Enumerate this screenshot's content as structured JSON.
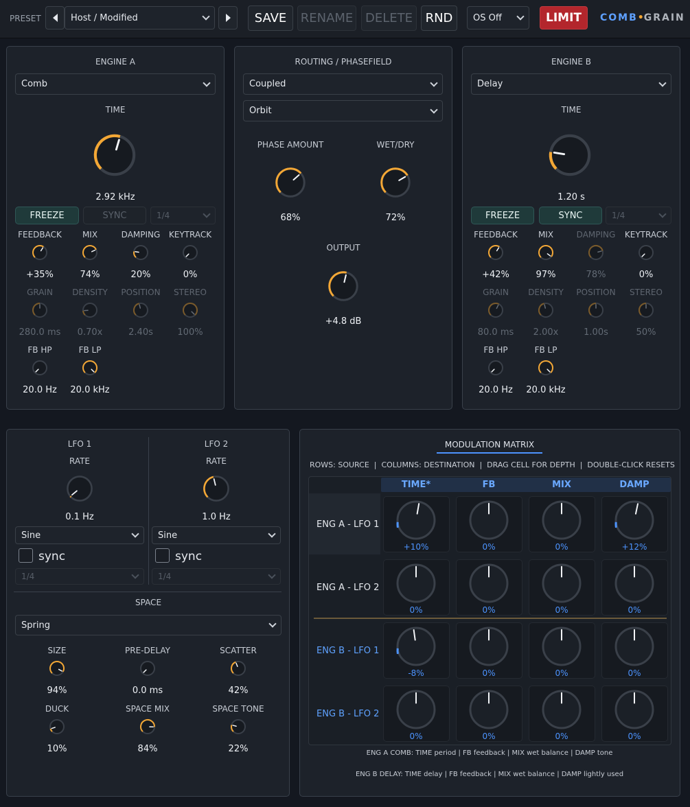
{
  "topbar": {
    "preset_label": "PRESET",
    "preset_value": "Host / Modified",
    "save": "SAVE",
    "rename": "RENAME",
    "delete": "DELETE",
    "rnd": "RND",
    "os_value": "OS Off",
    "limit": "LIMIT",
    "brand_left": "COMB",
    "brand_dot": "•",
    "brand_right": "GRAIN"
  },
  "engine_a": {
    "title": "ENGINE A",
    "mode": "Comb",
    "time_label": "TIME",
    "time_value": "2.92 kHz",
    "freeze": "FREEZE",
    "sync": "SYNC",
    "division": "1/4",
    "knobs_row1": [
      {
        "label": "FEEDBACK",
        "value": "+35%",
        "level": 0.62,
        "dim": false
      },
      {
        "label": "MIX",
        "value": "74%",
        "level": 0.74,
        "dim": false
      },
      {
        "label": "DAMPING",
        "value": "20%",
        "level": 0.2,
        "dim": false
      },
      {
        "label": "KEYTRACK",
        "value": "0%",
        "level": 0.0,
        "dim": false
      }
    ],
    "knobs_row2": [
      {
        "label": "GRAIN",
        "value": "280.0 ms",
        "level": 0.5,
        "dim": true
      },
      {
        "label": "DENSITY",
        "value": "0.70x",
        "level": 0.15,
        "dim": true
      },
      {
        "label": "POSITION",
        "value": "2.40s",
        "level": 0.45,
        "dim": true
      },
      {
        "label": "STEREO",
        "value": "100%",
        "level": 1.0,
        "dim": true
      }
    ],
    "knobs_row3": [
      {
        "label": "FB HP",
        "value": "20.0 Hz",
        "level": 0.0,
        "dim": false
      },
      {
        "label": "FB LP",
        "value": "20.0 kHz",
        "level": 1.0,
        "dim": false
      }
    ]
  },
  "routing": {
    "title": "ROUTING / PHASEFIELD",
    "mode": "Coupled",
    "shape": "Orbit",
    "phase_label": "PHASE AMOUNT",
    "phase_value": "68%",
    "wetdry_label": "WET/DRY",
    "wetdry_value": "72%",
    "output_label": "OUTPUT",
    "output_value": "+4.8 dB"
  },
  "engine_b": {
    "title": "ENGINE B",
    "mode": "Delay",
    "time_label": "TIME",
    "time_value": "1.20 s",
    "freeze": "FREEZE",
    "sync": "SYNC",
    "division": "1/4",
    "knobs_row1": [
      {
        "label": "FEEDBACK",
        "value": "+42%",
        "level": 0.62,
        "dim": false
      },
      {
        "label": "MIX",
        "value": "97%",
        "level": 0.97,
        "dim": false
      },
      {
        "label": "DAMPING",
        "value": "78%",
        "level": 0.78,
        "dim": true
      },
      {
        "label": "KEYTRACK",
        "value": "0%",
        "level": 0.0,
        "dim": false
      }
    ],
    "knobs_row2": [
      {
        "label": "GRAIN",
        "value": "80.0 ms",
        "level": 0.6,
        "dim": true
      },
      {
        "label": "DENSITY",
        "value": "2.00x",
        "level": 0.45,
        "dim": true
      },
      {
        "label": "POSITION",
        "value": "1.00s",
        "level": 0.5,
        "dim": true
      },
      {
        "label": "STEREO",
        "value": "50%",
        "level": 0.5,
        "dim": true
      }
    ],
    "knobs_row3": [
      {
        "label": "FB HP",
        "value": "20.0 Hz",
        "level": 0.0,
        "dim": false
      },
      {
        "label": "FB LP",
        "value": "20.0 kHz",
        "level": 1.0,
        "dim": false
      }
    ]
  },
  "lfo1": {
    "title": "LFO 1",
    "rate_label": "RATE",
    "rate_value": "0.1 Hz",
    "shape": "Sine",
    "sync": "sync",
    "division": "1/4"
  },
  "lfo2": {
    "title": "LFO 2",
    "rate_label": "RATE",
    "rate_value": "1.0 Hz",
    "shape": "Sine",
    "sync": "sync",
    "division": "1/4"
  },
  "space": {
    "title": "SPACE",
    "type": "Spring",
    "knobs_row1": [
      {
        "label": "SIZE",
        "value": "94%",
        "level": 0.94
      },
      {
        "label": "PRE-DELAY",
        "value": "0.0 ms",
        "level": 0.0
      },
      {
        "label": "SCATTER",
        "value": "42%",
        "level": 0.42
      }
    ],
    "knobs_row2": [
      {
        "label": "DUCK",
        "value": "10%",
        "level": 0.1
      },
      {
        "label": "SPACE MIX",
        "value": "84%",
        "level": 0.84
      },
      {
        "label": "SPACE TONE",
        "value": "22%",
        "level": 0.22
      }
    ]
  },
  "matrix": {
    "title": "MODULATION MATRIX",
    "hint": "ROWS: SOURCE  |  COLUMNS: DESTINATION  |  DRAG CELL FOR DEPTH  |  DOUBLE-CLICK RESETS",
    "columns": [
      "TIME*",
      "FB",
      "MIX",
      "DAMP"
    ],
    "rows": [
      {
        "label": "ENG A - LFO 1",
        "blue": false,
        "values": [
          "+10%",
          "0%",
          "0%",
          "+12%"
        ],
        "depths": [
          0.1,
          0,
          0,
          0.12
        ]
      },
      {
        "label": "ENG A - LFO 2",
        "blue": false,
        "values": [
          "0%",
          "0%",
          "0%",
          "0%"
        ],
        "depths": [
          0,
          0,
          0,
          0
        ]
      },
      {
        "label": "ENG B - LFO 1",
        "blue": true,
        "values": [
          "-8%",
          "0%",
          "0%",
          "0%"
        ],
        "depths": [
          -0.08,
          0,
          0,
          0
        ]
      },
      {
        "label": "ENG B - LFO 2",
        "blue": true,
        "values": [
          "0%",
          "0%",
          "0%",
          "0%"
        ],
        "depths": [
          0,
          0,
          0,
          0
        ]
      }
    ],
    "footer1": "ENG A COMB: TIME period | FB feedback | MIX wet balance | DAMP tone",
    "footer2": "ENG B DELAY: TIME delay | FB feedback | MIX wet balance | DAMP lightly used"
  },
  "knob_levels": {
    "engine_a_time": 0.56,
    "engine_b_time": 0.2,
    "phase_amount": 0.68,
    "wet_dry": 0.72,
    "output": 0.55,
    "lfo1_rate": 0.02,
    "lfo2_rate": 0.45
  },
  "colors": {
    "accent": "#f3a735",
    "limit": "#b3262c",
    "brand_blue": "#5ea0ff",
    "matrix_blue": "#4d94ff"
  }
}
